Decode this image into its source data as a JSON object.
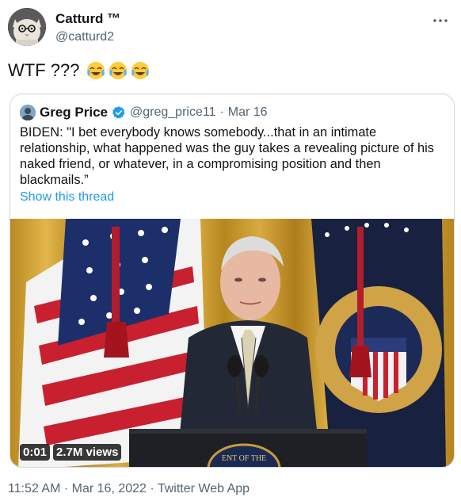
{
  "author": {
    "name": "Catturd ™",
    "handle": "@catturd2"
  },
  "icons": {
    "more": "more-horizontal-icon",
    "emoji": "face-with-tears-of-joy-icon",
    "verified": "verified-badge-icon"
  },
  "tweet": {
    "text": "WTF ???",
    "emoji_count": 3
  },
  "quote": {
    "name": "Greg Price",
    "handle": "@greg_price11",
    "separator": "·",
    "date": "Mar 16",
    "body": "BIDEN: \"I bet everybody knows somebody...that in an intimate relationship, what happened was the guy takes a revealing picture of his naked friend, or whatever, in a compromising position and then blackmails.”",
    "show_thread": "Show this thread",
    "video": {
      "time": "0:01",
      "views": "2.7M views",
      "seal_text": "ENT OF THE"
    }
  },
  "meta": {
    "time": "11:52 AM",
    "sep1": " · ",
    "date": "Mar 16, 2022",
    "sep2": " · ",
    "app": "Twitter Web App"
  },
  "colors": {
    "link": "#1d9bf0",
    "secondary_text": "#536471",
    "border": "#cfd9de"
  }
}
